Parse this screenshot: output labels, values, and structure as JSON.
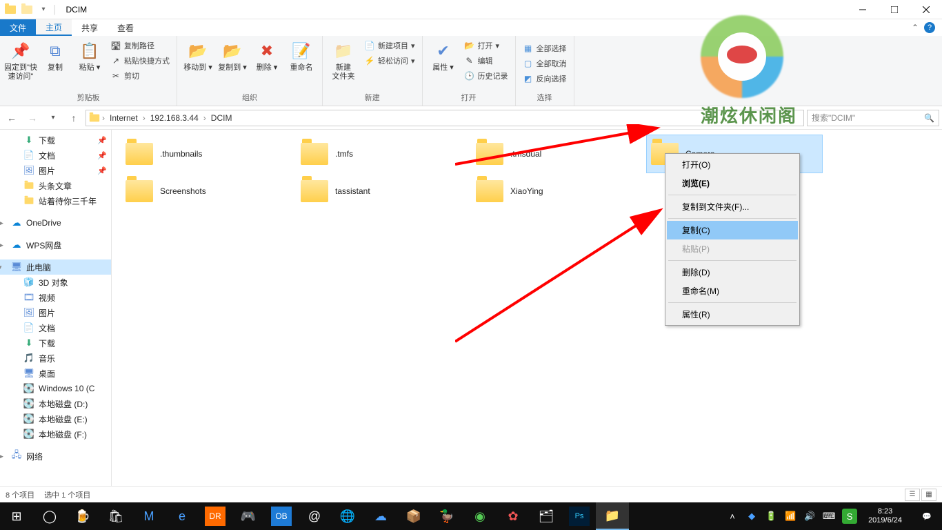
{
  "window": {
    "title": "DCIM"
  },
  "tabs": {
    "file": "文件",
    "home": "主页",
    "share": "共享",
    "view": "查看"
  },
  "ribbon": {
    "pin": "固定到\"快\n速访问\"",
    "copy": "复制",
    "paste": "粘贴",
    "copypath": "复制路径",
    "pasteshortcut": "粘贴快捷方式",
    "cut": "剪切",
    "clipboard_label": "剪贴板",
    "moveto": "移动到",
    "copyto": "复制到",
    "delete": "删除",
    "rename": "重命名",
    "organize_label": "组织",
    "newfolder": "新建\n文件夹",
    "newitem": "新建项目",
    "easyaccess": "轻松访问",
    "new_label": "新建",
    "properties": "属性",
    "open": "打开",
    "edit": "编辑",
    "history": "历史记录",
    "open_label": "打开",
    "selectall": "全部选择",
    "selectnone": "全部取消",
    "invert": "反向选择",
    "select_label": "选择"
  },
  "breadcrumb": {
    "p1": "Internet",
    "p2": "192.168.3.44",
    "p3": "DCIM"
  },
  "search": {
    "placeholder": "搜索\"DCIM\""
  },
  "nav": {
    "downloads": "下载",
    "documents": "文档",
    "pictures": "图片",
    "toutiao": "头条文章",
    "zhanzhuo": "站着待你三千年",
    "onedrive": "OneDrive",
    "wps": "WPS网盘",
    "thispc": "此电脑",
    "obj3d": "3D 对象",
    "videos": "视频",
    "pictures2": "图片",
    "documents2": "文档",
    "downloads2": "下载",
    "music": "音乐",
    "desktop": "桌面",
    "windows10": "Windows 10 (C",
    "diskD": "本地磁盘 (D:)",
    "diskE": "本地磁盘 (E:)",
    "diskF": "本地磁盘 (F:)",
    "network": "网络"
  },
  "folders": [
    ".thumbnails",
    ".tmfs",
    ".tmsdual",
    "Camera",
    "Screenshots",
    "tassistant",
    "XiaoYing"
  ],
  "context": {
    "open": "打开(O)",
    "browse": "浏览(E)",
    "copytofolder": "复制到文件夹(F)...",
    "copy": "复制(C)",
    "paste": "粘贴(P)",
    "delete": "删除(D)",
    "rename": "重命名(M)",
    "props": "属性(R)"
  },
  "status": {
    "count": "8 个项目",
    "sel": "选中 1 个项目"
  },
  "tray": {
    "time": "8:23",
    "date": "2019/6/24"
  },
  "watermark": "潮炫休闲阁"
}
